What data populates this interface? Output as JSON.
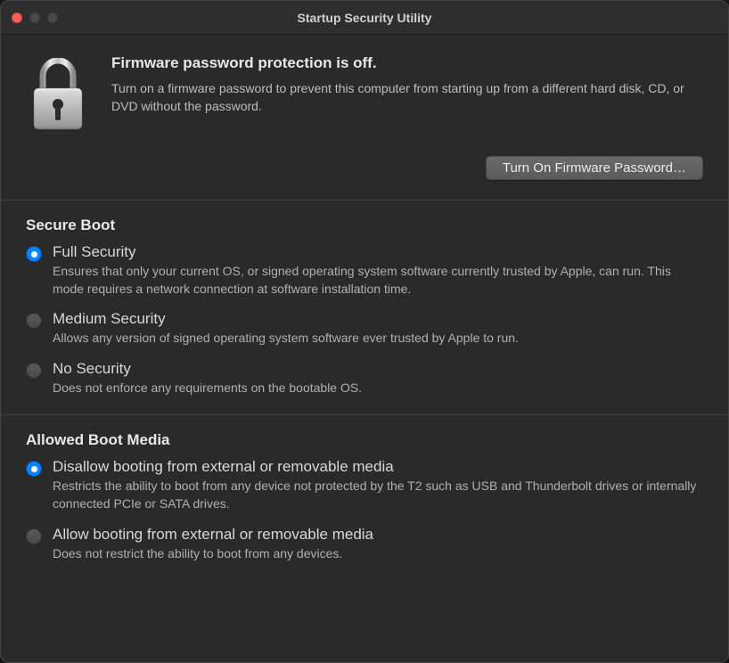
{
  "window": {
    "title": "Startup Security Utility"
  },
  "firmware": {
    "heading": "Firmware password protection is off.",
    "description": "Turn on a firmware password to prevent this computer from starting up from a different hard disk, CD, or DVD without the password.",
    "button_label": "Turn On Firmware Password…"
  },
  "secure_boot": {
    "title": "Secure Boot",
    "options": [
      {
        "label": "Full Security",
        "description": "Ensures that only your current OS, or signed operating system software currently trusted by Apple, can run. This mode requires a network connection at software installation time.",
        "selected": true
      },
      {
        "label": "Medium Security",
        "description": "Allows any version of signed operating system software ever trusted by Apple to run.",
        "selected": false
      },
      {
        "label": "No Security",
        "description": "Does not enforce any requirements on the bootable OS.",
        "selected": false
      }
    ]
  },
  "boot_media": {
    "title": "Allowed Boot Media",
    "options": [
      {
        "label": "Disallow booting from external or removable media",
        "description": "Restricts the ability to boot from any device not protected by the T2 such as USB and Thunderbolt drives or internally connected PCIe or SATA drives.",
        "selected": true
      },
      {
        "label": "Allow booting from external or removable media",
        "description": "Does not restrict the ability to boot from any devices.",
        "selected": false
      }
    ]
  }
}
